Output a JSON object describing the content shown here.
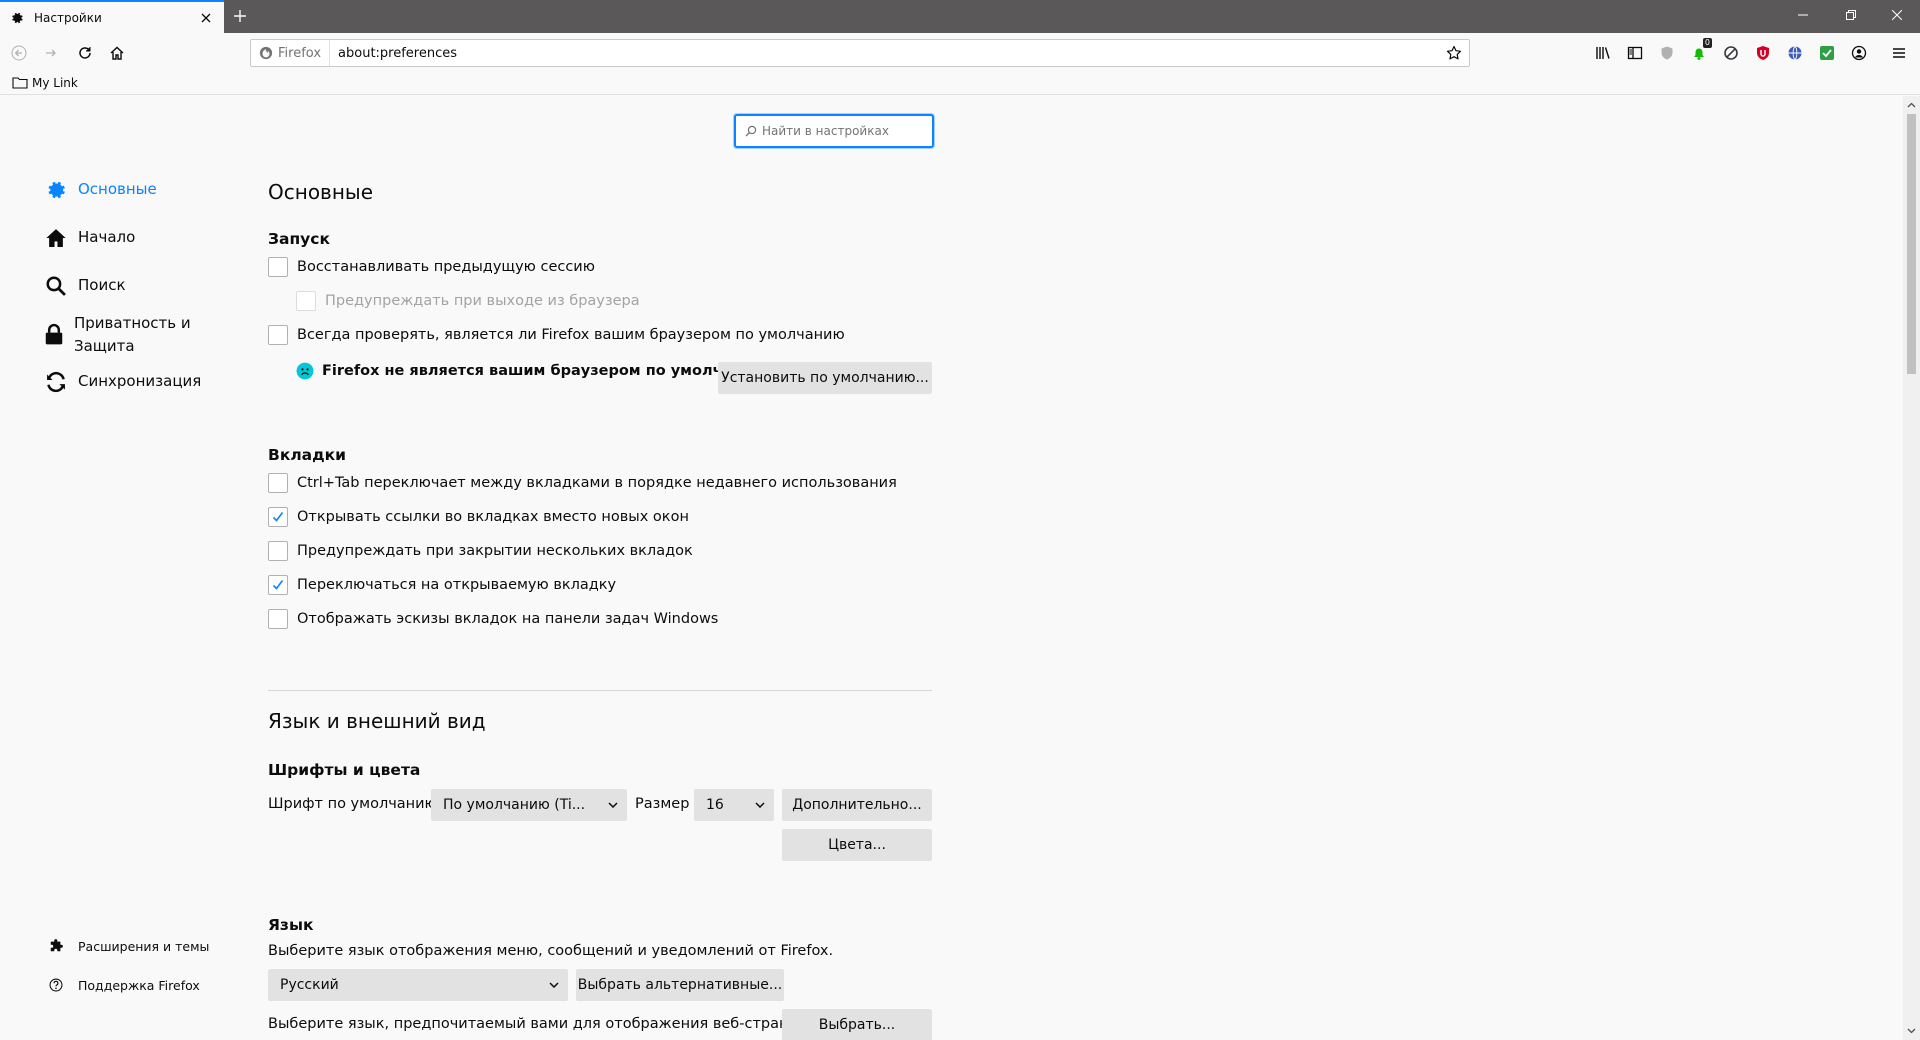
{
  "tab": {
    "title": "Настройки"
  },
  "window": {
    "minimize": "–",
    "restore": "❐",
    "close": "✕"
  },
  "urlbar": {
    "identity_label": "Firefox",
    "url": "about:preferences"
  },
  "toolbar": {
    "badge_count": "0"
  },
  "bookmarks": {
    "items": [
      {
        "label": "My Link"
      }
    ]
  },
  "search": {
    "placeholder": "Найти в настройках"
  },
  "sidebar": {
    "items": [
      {
        "label": "Основные",
        "icon": "gear-icon",
        "selected": true
      },
      {
        "label": "Начало",
        "icon": "home-icon"
      },
      {
        "label": "Поиск",
        "icon": "search-icon"
      },
      {
        "label": "Приватность и Защита",
        "icon": "lock-icon"
      },
      {
        "label": "Синхронизация",
        "icon": "sync-icon"
      }
    ],
    "footer": [
      {
        "label": "Расширения и темы",
        "icon": "puzzle-icon"
      },
      {
        "label": "Поддержка Firefox",
        "icon": "help-icon"
      }
    ]
  },
  "general": {
    "title": "Основные",
    "startup": {
      "title": "Запуск",
      "restore_session": {
        "label": "Восстанавливать предыдущую сессию",
        "checked": false
      },
      "warn_on_quit": {
        "label": "Предупреждать при выходе из браузера",
        "checked": false,
        "disabled": true
      },
      "check_default": {
        "label": "Всегда проверять, является ли Firefox вашим браузером по умолчанию",
        "checked": false
      },
      "default_status": "Firefox не является вашим браузером по умолчанию",
      "set_default_button": "Установить по умолчанию..."
    },
    "tabs": {
      "title": "Вкладки",
      "items": [
        {
          "label": "Ctrl+Tab переключает между вкладками в порядке недавнего использования",
          "checked": false
        },
        {
          "label": "Открывать ссылки во вкладках вместо новых окон",
          "checked": true
        },
        {
          "label": "Предупреждать при закрытии нескольких вкладок",
          "checked": false
        },
        {
          "label": "Переключаться на открываемую вкладку",
          "checked": true
        },
        {
          "label": "Отображать эскизы вкладок на панели задач Windows",
          "checked": false
        }
      ]
    }
  },
  "appearance": {
    "title": "Язык и внешний вид",
    "fonts": {
      "title": "Шрифты и цвета",
      "default_font_label": "Шрифт по умолчанию",
      "default_font_value": "По умолчанию (Ti...",
      "size_label": "Размер",
      "size_value": "16",
      "advanced_button": "Дополнительно...",
      "colors_button": "Цвета..."
    },
    "language": {
      "title": "Язык",
      "description": "Выберите язык отображения меню, сообщений и уведомлений от Firefox.",
      "selected_language": "Русский",
      "alternatives_button": "Выбрать альтернативные...",
      "web_pages_description": "Выберите язык, предпочитаемый вами для отображения веб-страниц",
      "choose_button": "Выбрать..."
    }
  },
  "colors": {
    "accent": "#0a84ff",
    "tabbar": "#5a5858",
    "button": "#e2e2e3"
  }
}
